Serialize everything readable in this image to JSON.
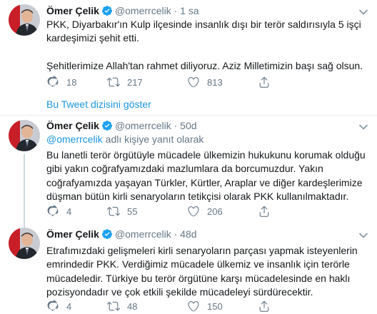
{
  "tweets": [
    {
      "name": "Ömer Çelik",
      "handle": "@omerrcelik",
      "separator": "·",
      "time": "1 sa",
      "lines": [
        "PKK, Diyarbakır'ın Kulp ilçesinde insanlık dışı bir terör saldırısıyla 5 işçi kardeşimizi şehit etti.",
        "",
        "Şehitlerimize Allah'tan rahmet diliyoruz. Aziz Milletimizin başı sağ olsun."
      ],
      "replies": "18",
      "retweets": "217",
      "likes": "813"
    },
    {
      "name": "Ömer Çelik",
      "handle": "@omerrcelik",
      "separator": "·",
      "time": "50d",
      "reply_mention": "@omerrcelik",
      "reply_text": " adlı kişiye yanıt olarak",
      "lines": [
        "Bu lanetli terör örgütüyle mücadele ülkemizin hukukunu korumak olduğu gibi yakın coğrafyamızdaki mazlumlara da borcumuzdur. Yakın coğrafyamızda yaşayan Türkler, Kürtler, Araplar ve diğer kardeşlerimize düşman bütün kirli senaryoların tetikçisi olarak PKK kullanılmaktadır."
      ],
      "replies": "4",
      "retweets": "55",
      "likes": "206"
    },
    {
      "name": "Ömer Çelik",
      "handle": "@omerrcelik",
      "separator": "·",
      "time": "48d",
      "lines": [
        "Etrafımızdaki gelişmeleri kirli senaryoların parçası yapmak isteyenlerin emrindedir PKK. Verdiğimiz mücadele ülkemiz ve insanlık için terörle mücadeledir. Türkiye bu terör örgütüne karşı mücadelesinde en haklı pozisyondadır ve çok etkili şekilde mücadeleyi sürdürecektir."
      ],
      "replies": "4",
      "retweets": "48",
      "likes": "150"
    }
  ],
  "show_thread": "Bu Tweet dizisini göster",
  "colors": {
    "link": "#1b95e0",
    "muted": "#657786",
    "divider": "#e6ecf0",
    "verified": "#1da1f2"
  },
  "icons": [
    "verified-badge-icon",
    "chevron-down-icon",
    "reply-icon",
    "retweet-icon",
    "like-icon",
    "share-icon"
  ]
}
